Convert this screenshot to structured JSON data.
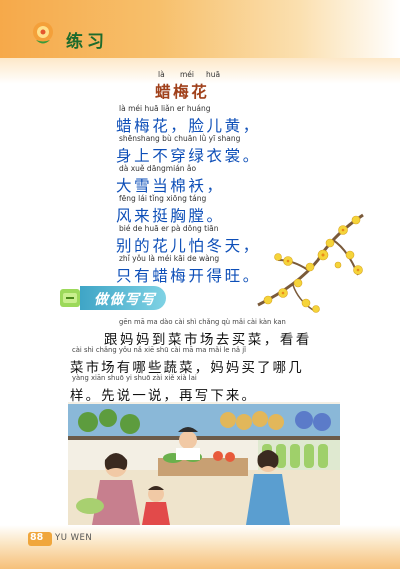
{
  "header": {
    "title": "练习",
    "icon": "flower-icon"
  },
  "poem": {
    "title": {
      "pinyin": [
        "là",
        "méi",
        "huā"
      ],
      "text": "蜡梅花"
    },
    "lines": [
      {
        "pinyin": "là méi huā      liǎn er huáng",
        "text": "蜡梅花，脸儿黄，"
      },
      {
        "pinyin": "shēnshang bù chuān lǜ  yī shang",
        "text": "身上不穿绿衣裳。"
      },
      {
        "pinyin": "dà  xuě dāngmián ǎo",
        "text": "大雪当棉袄，"
      },
      {
        "pinyin": "fēng lái  tǐng xiōng táng",
        "text": "风来挺胸膛。"
      },
      {
        "pinyin": "bié   de  huā  er   pà  dōng tiān",
        "text": "别的花儿怕冬天，"
      },
      {
        "pinyin": "zhǐ  yǒu  là  méi  kāi  de wàng",
        "text": "只有蜡梅开得旺。"
      }
    ]
  },
  "section": {
    "title": "做做写写"
  },
  "exercise": {
    "lines": [
      {
        "pinyin": "gēn  mā  ma  dào  cài  shì chǎng qù  mǎi  cài       kàn kan",
        "text": "跟妈妈到菜市场去买菜，看看"
      },
      {
        "pinyin": "cài  shì chǎng yǒu  nǎ  xiē  shū  cài      mā  ma mǎi  le   nǎ   jǐ",
        "text": "菜市场有哪些蔬菜，妈妈买了哪几"
      },
      {
        "pinyin": "yàng   xiān shuō  yi  shuō     zài  xiě  xià lai",
        "text": "样。先说一说，再写下来。"
      }
    ]
  },
  "footer": {
    "page_number": "88",
    "subject": "YU WEN"
  },
  "colors": {
    "accent": "#f6a94a",
    "title_green": "#1d6b2c",
    "poem_blue": "#0e4fb8",
    "banner": "#3fa5c6"
  }
}
